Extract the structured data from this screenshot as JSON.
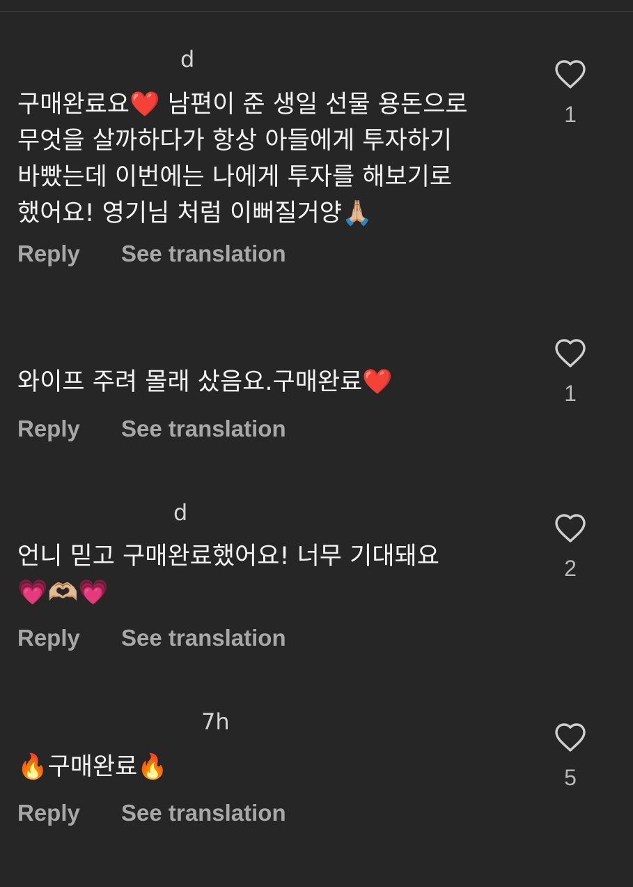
{
  "comments": [
    {
      "username_visible": "d",
      "username_hidden": "",
      "time": "",
      "text": "구매완료요❤️ 남편이 준 생일 선물 용돈으로\n무엇을 살까하다가 항상 아들에게 투자하기\n바빴는데 이번에는 나에게 투자를 해보기로\n했어요! 영기님 처럼 이뻐질거양🙏🏼",
      "reply_label": "Reply",
      "translate_label": "See translation",
      "likes": "1"
    },
    {
      "username_visible": "",
      "username_hidden": "",
      "time": "",
      "text": "와이프 주려 몰래 샀음요.구매완료❤️",
      "reply_label": "Reply",
      "translate_label": "See translation",
      "likes": "1"
    },
    {
      "username_visible": "d",
      "username_hidden": "",
      "time": "",
      "text": "언니 믿고 구매완료했어요! 너무 기대돼요\n💗🫶🏼💗",
      "reply_label": "Reply",
      "translate_label": "See translation",
      "likes": "2"
    },
    {
      "username_visible": "",
      "username_hidden": "",
      "time": "7h",
      "text": "🔥구매완료🔥",
      "reply_label": "Reply",
      "translate_label": "See translation",
      "likes": "5"
    }
  ],
  "colors": {
    "background": "#262626",
    "text": "#f4f4f4",
    "secondary": "#a8a8a8",
    "like_outline": "#cfcfcf"
  },
  "icons": {
    "like": "heart-outline-icon"
  }
}
